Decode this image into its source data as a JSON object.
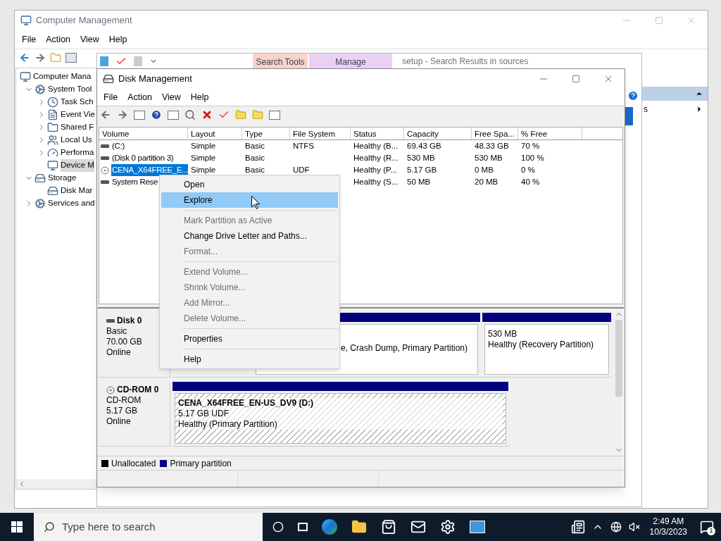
{
  "computer_management": {
    "title": "Computer Management",
    "menu": [
      "File",
      "Action",
      "View",
      "Help"
    ],
    "tree": [
      {
        "label": "Computer Mana",
        "children": [
          {
            "label": "System Tool",
            "expanded": true,
            "children": [
              {
                "label": "Task Sch",
                "expanded": false,
                "selected": false
              },
              {
                "label": "Event Vie",
                "expanded": false,
                "selected": false
              },
              {
                "label": "Shared F",
                "expanded": false,
                "selected": false
              },
              {
                "label": "Local Us",
                "expanded": false,
                "selected": false
              },
              {
                "label": "Performa",
                "expanded": false,
                "selected": false
              },
              {
                "label": "Device M",
                "selected": true
              }
            ]
          },
          {
            "label": "Storage",
            "expanded": true,
            "children": [
              {
                "label": "Disk Mar",
                "selected": false
              }
            ]
          },
          {
            "label": "Services and",
            "expanded": false,
            "selected": false
          }
        ]
      }
    ],
    "actions_item": "s"
  },
  "explorer": {
    "title": "setup - Search Results in sources",
    "tabs": [
      {
        "label": "Search Tools",
        "color": "#f9d3c6"
      },
      {
        "label": "Manage",
        "color": "#ead0f4"
      }
    ]
  },
  "disk_management": {
    "title": "Disk Management",
    "menu": [
      "File",
      "Action",
      "View",
      "Help"
    ],
    "columns": [
      "Volume",
      "Layout",
      "Type",
      "File System",
      "Status",
      "Capacity",
      "Free Spa...",
      "% Free"
    ],
    "rows": [
      {
        "kind": "disk",
        "selected": false,
        "cells": [
          "(C:)",
          "Simple",
          "Basic",
          "NTFS",
          "Healthy (B...",
          "69.43 GB",
          "48.33 GB",
          "70 %"
        ]
      },
      {
        "kind": "disk",
        "selected": false,
        "cells": [
          "(Disk 0 partition 3)",
          "Simple",
          "Basic",
          "",
          "Healthy (R...",
          "530 MB",
          "530 MB",
          "100 %"
        ]
      },
      {
        "kind": "cdrom",
        "selected": true,
        "cells": [
          "CENA_X64FREE_E...",
          "Simple",
          "Basic",
          "UDF",
          "Healthy (P...",
          "5.17 GB",
          "0 MB",
          "0 %"
        ]
      },
      {
        "kind": "disk",
        "selected": false,
        "cells": [
          "System Rese",
          "",
          "",
          "",
          "Healthy (S...",
          "50 MB",
          "20 MB",
          "40 %"
        ]
      }
    ],
    "context_menu": [
      {
        "kind": "item",
        "label": "Open",
        "disabled": false,
        "selected": false
      },
      {
        "kind": "item",
        "label": "Explore",
        "disabled": false,
        "selected": true
      },
      {
        "kind": "separator"
      },
      {
        "kind": "item",
        "label": "Mark Partition as Active",
        "disabled": true,
        "selected": false
      },
      {
        "kind": "item",
        "label": "Change Drive Letter and Paths...",
        "disabled": false,
        "selected": false
      },
      {
        "kind": "item",
        "label": "Format...",
        "disabled": true,
        "selected": false
      },
      {
        "kind": "separator"
      },
      {
        "kind": "item",
        "label": "Extend Volume...",
        "disabled": true,
        "selected": false
      },
      {
        "kind": "item",
        "label": "Shrink Volume...",
        "disabled": true,
        "selected": false
      },
      {
        "kind": "item",
        "label": "Add Mirror...",
        "disabled": true,
        "selected": false
      },
      {
        "kind": "item",
        "label": "Delete Volume...",
        "disabled": true,
        "selected": false
      },
      {
        "kind": "separator"
      },
      {
        "kind": "item",
        "label": "Properties",
        "disabled": false,
        "selected": false
      },
      {
        "kind": "separator"
      },
      {
        "kind": "item",
        "label": "Help",
        "disabled": false,
        "selected": false
      }
    ],
    "disks": [
      {
        "kind": "disk",
        "name": "Disk 0",
        "type": "Basic",
        "size": "70.00 GB",
        "status": "Online",
        "partitions": [
          {
            "selected": false,
            "lines": [
              "e, Crash Dump, Primary Partition)"
            ]
          },
          {
            "selected": false,
            "lines": [
              "530 MB",
              "Healthy (Recovery Partition)"
            ]
          }
        ]
      },
      {
        "kind": "cdrom",
        "name": "CD-ROM 0",
        "type": "CD-ROM",
        "size": "5.17 GB",
        "status": "Online",
        "partitions": [
          {
            "selected": true,
            "title": "CENA_X64FREE_EN-US_DV9  (D:)",
            "lines": [
              "5.17 GB UDF",
              "Healthy (Primary Partition)"
            ]
          }
        ]
      }
    ],
    "legend": [
      {
        "label": "Unallocated",
        "color": "#000000"
      },
      {
        "label": "Primary partition",
        "color": "#00007f"
      }
    ]
  },
  "taskbar": {
    "search_placeholder": "Type here to search",
    "time": "2:49 AM",
    "date": "10/3/2023",
    "notifications": "1"
  }
}
